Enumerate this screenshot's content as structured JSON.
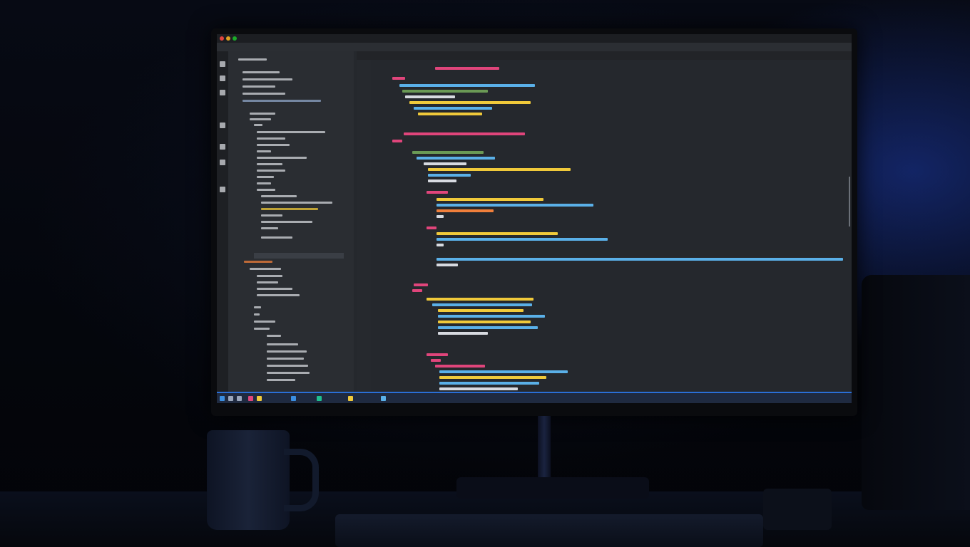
{
  "scene": {
    "type": "photo-of-monitor-running-code-editor",
    "colors": {
      "background": "#05070d",
      "ambient_glow": "#1e3caa",
      "editor_bg": "#25282d",
      "sidebar_bg": "#2a2d32",
      "taskbar_accent": "#2a6fd6"
    }
  },
  "ide": {
    "window_controls": [
      {
        "name": "close-icon",
        "color": "#e0443e"
      },
      {
        "name": "minimize-icon",
        "color": "#dea123"
      },
      {
        "name": "maximize-icon",
        "color": "#1aab29"
      }
    ],
    "activity_icons": [
      "explorer-icon",
      "search-icon",
      "source-control-icon",
      "debug-icon",
      "extensions-icon",
      "cursor-icon",
      "settings-icon"
    ],
    "code_colors": {
      "keyword": "#e0457b",
      "string": "#f0c93a",
      "function": "#5ab0e8",
      "variable": "#d7dae0",
      "comment": "#6a9955",
      "accent": "#f07f3b"
    },
    "taskbar_icons": [
      "start-icon",
      "search-icon",
      "taskview-icon",
      "browser-icon",
      "folder-icon",
      "terminal-icon",
      "editor-icon",
      "mail-icon",
      "app-icon"
    ]
  }
}
